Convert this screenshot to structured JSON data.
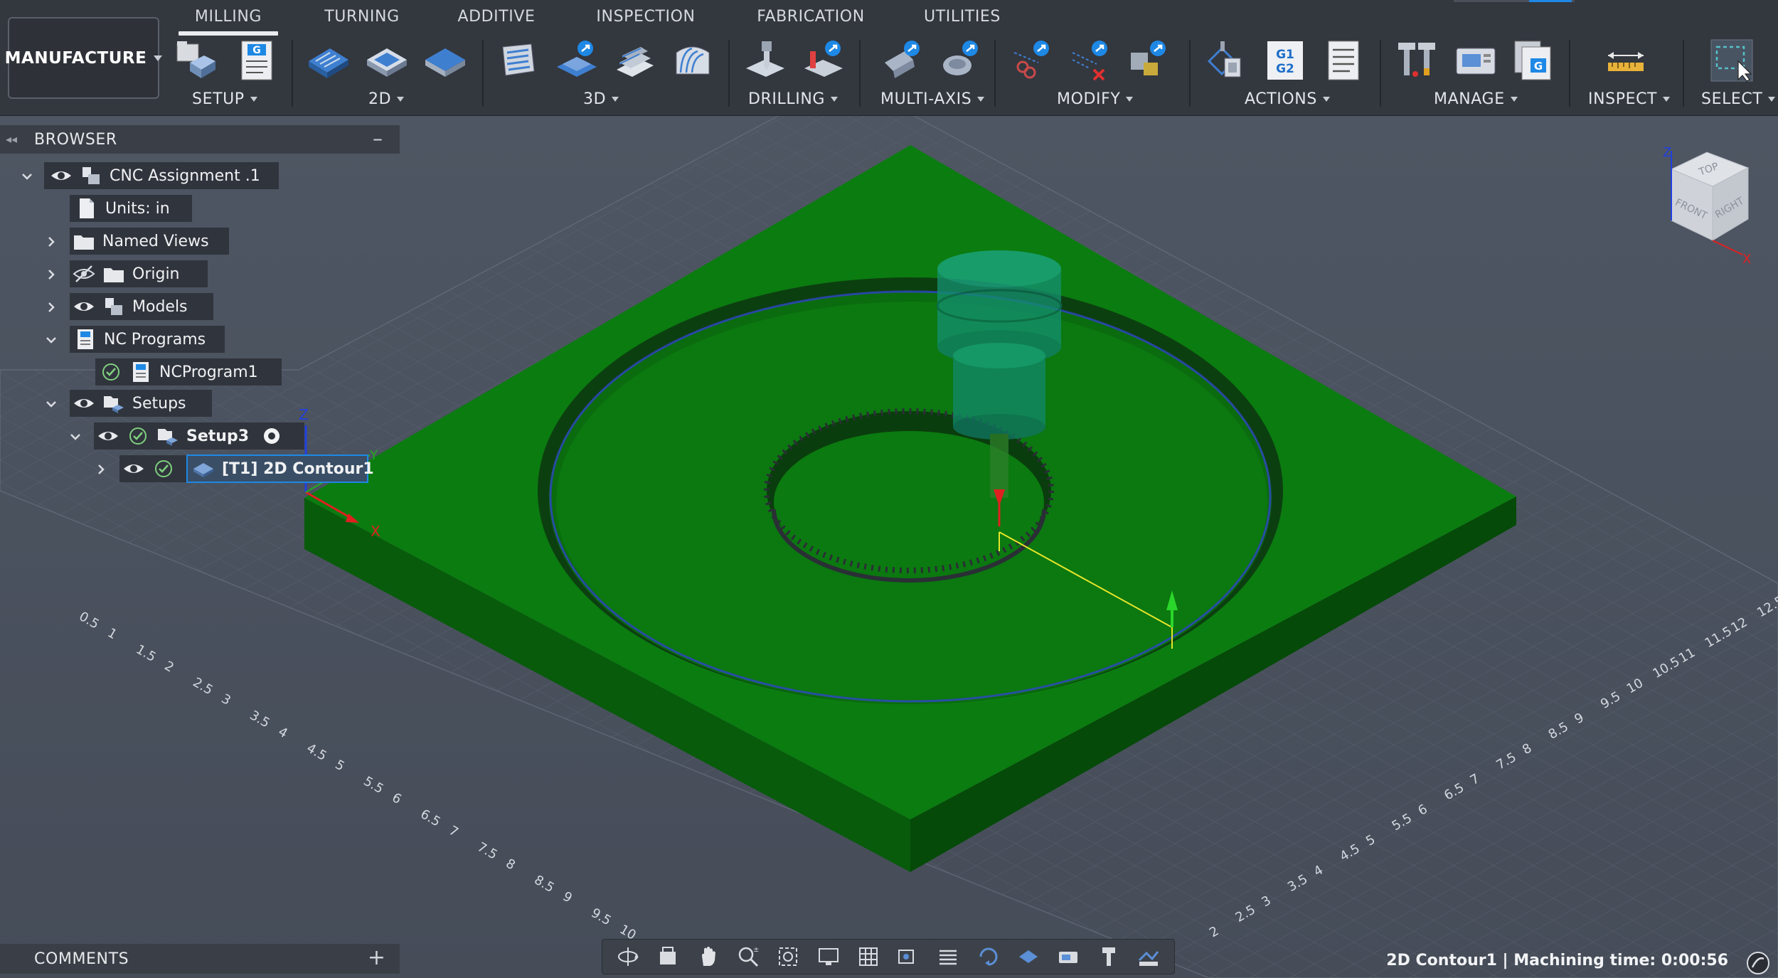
{
  "workspace": {
    "label": "MANUFACTURE"
  },
  "tabs": [
    {
      "label": "MILLING",
      "active": true
    },
    {
      "label": "TURNING"
    },
    {
      "label": "ADDITIVE"
    },
    {
      "label": "INSPECTION"
    },
    {
      "label": "FABRICATION"
    },
    {
      "label": "UTILITIES"
    }
  ],
  "groups": {
    "setup": "SETUP",
    "twod": "2D",
    "threed": "3D",
    "drilling": "DRILLING",
    "multiaxis": "MULTI-AXIS",
    "modify": "MODIFY",
    "actions": "ACTIONS",
    "manage": "MANAGE",
    "inspect": "INSPECT",
    "select": "SELECT"
  },
  "icons": {
    "actions_post": "G1 G2",
    "setup_nc": "G"
  },
  "browser": {
    "title": "BROWSER",
    "items": [
      {
        "label": "CNC Assignment .1"
      },
      {
        "label": "Units: in"
      },
      {
        "label": "Named Views"
      },
      {
        "label": "Origin"
      },
      {
        "label": "Models"
      },
      {
        "label": "NC Programs"
      },
      {
        "label": "NCProgram1"
      },
      {
        "label": "Setups"
      },
      {
        "label": "Setup3"
      },
      {
        "label": "[T1] 2D Contour1"
      }
    ]
  },
  "comments": {
    "title": "COMMENTS"
  },
  "status": {
    "text": "2D Contour1 | Machining time: 0:00:56"
  },
  "viewcube": {
    "top": "TOP",
    "front": "FRONT",
    "right": "RIGHT",
    "axis_z": "Z",
    "axis_x": "X"
  },
  "origin_axes": {
    "x": "X",
    "y": "Y",
    "z": "Z"
  },
  "grid_labels": {
    "left": [
      "0.5",
      "1",
      "1.5",
      "2",
      "2.5",
      "3",
      "3.5",
      "4",
      "4.5",
      "5",
      "5.5",
      "6",
      "6.5",
      "7",
      "7.5",
      "8",
      "8.5",
      "9",
      "9.5",
      "10"
    ],
    "right": [
      "2",
      "2.5",
      "3",
      "3.5",
      "4",
      "4.5",
      "5",
      "5.5",
      "6",
      "6.5",
      "7",
      "7.5",
      "8",
      "8.5",
      "9",
      "9.5",
      "10",
      "10.5",
      "11",
      "11.5",
      "12",
      "12.5"
    ]
  },
  "colors": {
    "stock": "#0e7a12",
    "stock_side": "#064d09",
    "background": "#4c5461",
    "toolbar": "#33373e",
    "accent_blue": "#1e88e5"
  }
}
